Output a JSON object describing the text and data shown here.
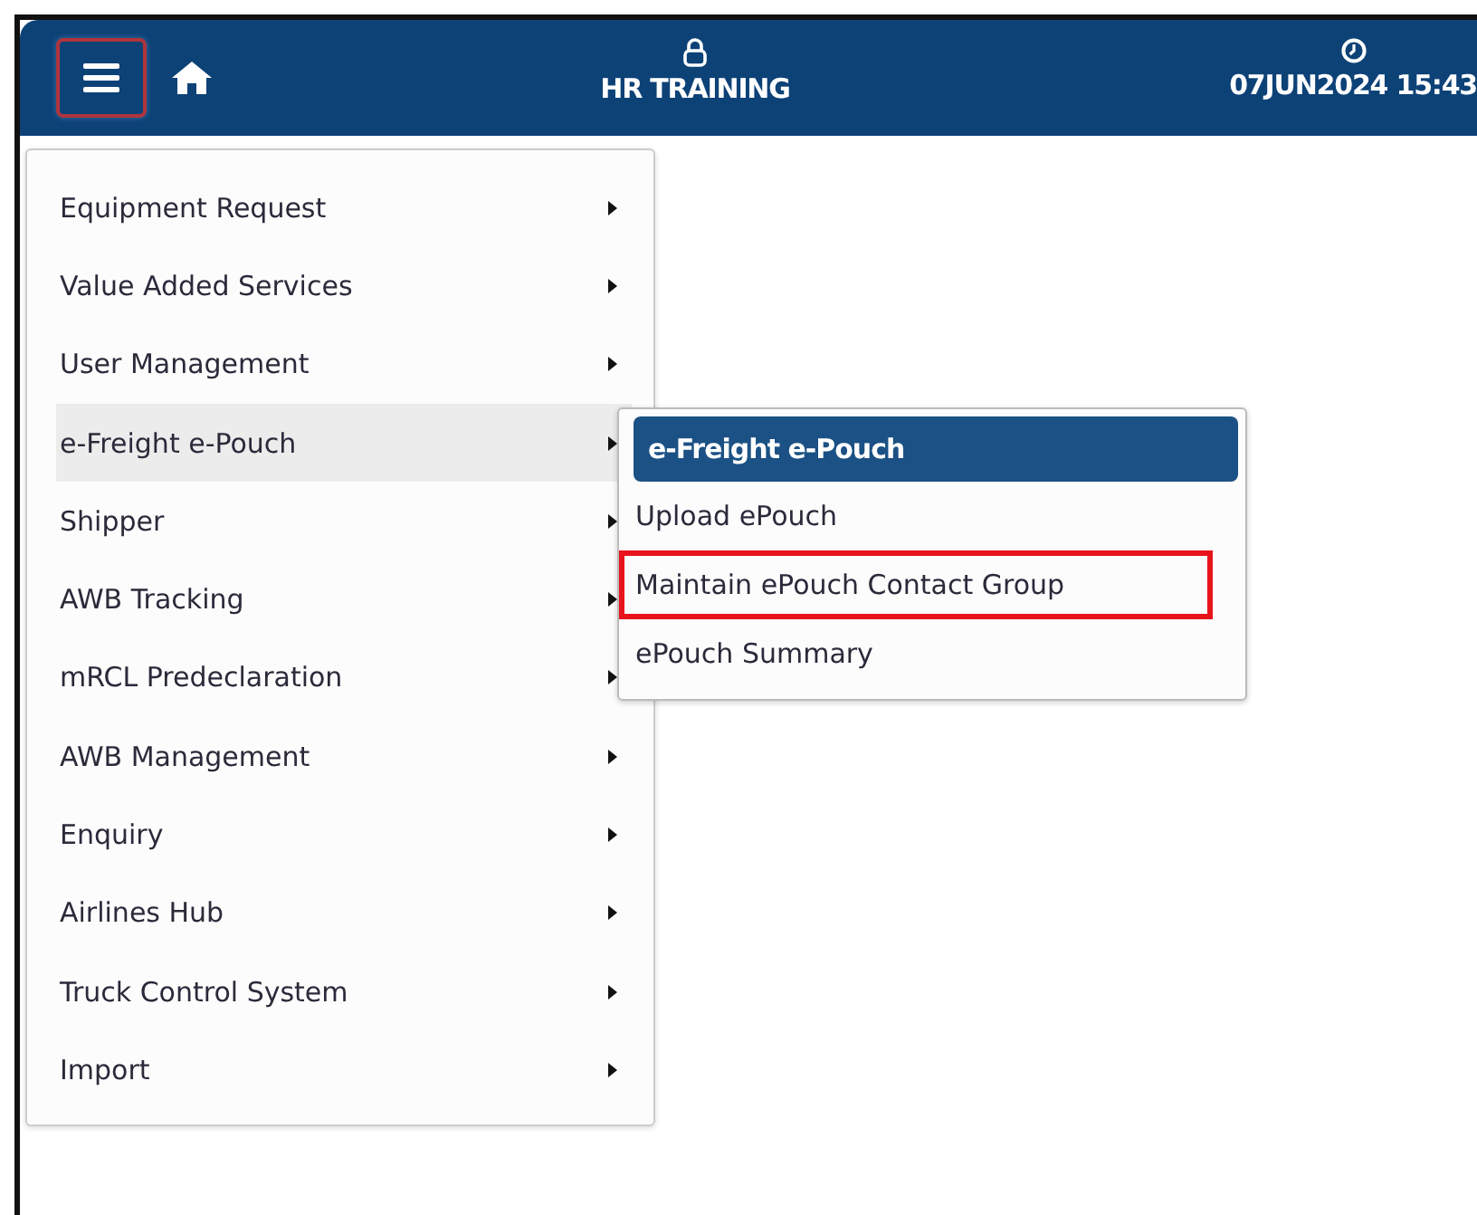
{
  "header": {
    "user": "HR TRAINING",
    "datetime": "07JUN2024 15:43",
    "menu_open": true
  },
  "menu": {
    "items": [
      {
        "label": "Equipment Request",
        "selected": false
      },
      {
        "label": "Value Added Services",
        "selected": false
      },
      {
        "label": "User Management",
        "selected": false
      },
      {
        "label": "e-Freight e-Pouch",
        "selected": true
      },
      {
        "label": "Shipper",
        "selected": false
      },
      {
        "label": "AWB Tracking",
        "selected": false
      },
      {
        "label": "mRCL Predeclaration",
        "selected": false
      },
      {
        "label": "AWB Management",
        "selected": false
      },
      {
        "label": "Enquiry",
        "selected": false
      },
      {
        "label": "Airlines Hub",
        "selected": false
      },
      {
        "label": "Truck Control System",
        "selected": false
      },
      {
        "label": "Import",
        "selected": false
      }
    ]
  },
  "submenu": {
    "title": "e-Freight e-Pouch",
    "items": [
      {
        "label": "Upload ePouch",
        "highlighted": false
      },
      {
        "label": "Maintain ePouch Contact Group",
        "highlighted": true
      },
      {
        "label": "ePouch Summary",
        "highlighted": false
      }
    ]
  }
}
